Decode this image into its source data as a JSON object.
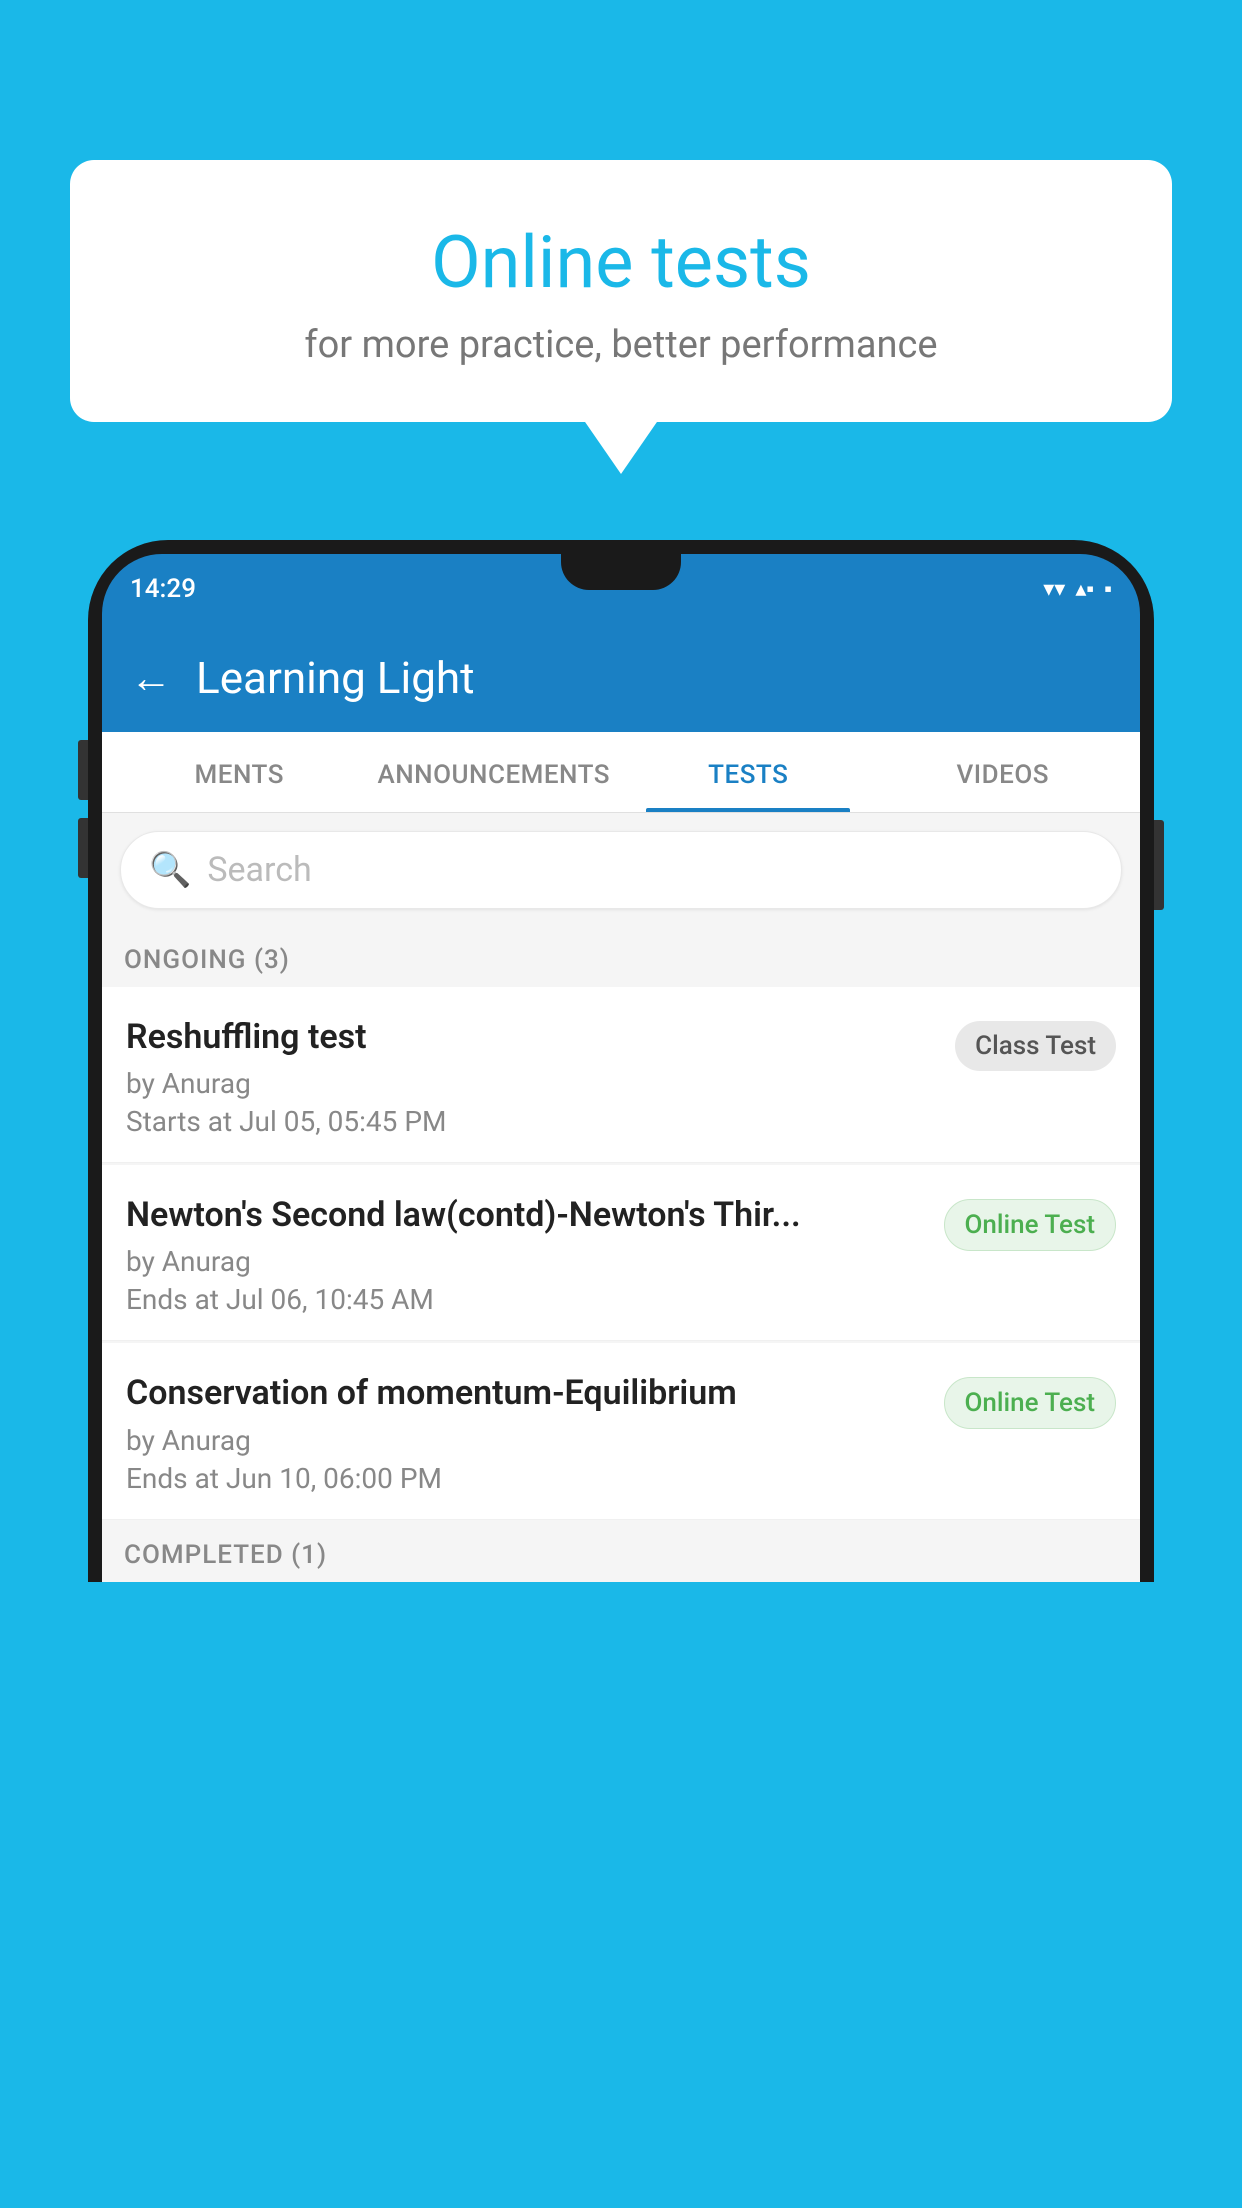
{
  "background_color": "#1ab8e8",
  "speech_bubble": {
    "title": "Online tests",
    "subtitle": "for more practice, better performance"
  },
  "phone": {
    "status_bar": {
      "time": "14:29",
      "wifi_icon": "▾",
      "signal_icon": "▴▴",
      "battery_icon": "▪"
    },
    "app_header": {
      "back_label": "←",
      "title": "Learning Light"
    },
    "tabs": [
      {
        "label": "MENTS",
        "active": false
      },
      {
        "label": "ANNOUNCEMENTS",
        "active": false
      },
      {
        "label": "TESTS",
        "active": true
      },
      {
        "label": "VIDEOS",
        "active": false
      }
    ],
    "search": {
      "placeholder": "Search"
    },
    "ongoing_section": {
      "label": "ONGOING (3)",
      "tests": [
        {
          "name": "Reshuffling test",
          "author": "by Anurag",
          "time_label": "Starts at",
          "time": "Jul 05, 05:45 PM",
          "badge": "Class Test",
          "badge_type": "class"
        },
        {
          "name": "Newton's Second law(contd)-Newton's Thir...",
          "author": "by Anurag",
          "time_label": "Ends at",
          "time": "Jul 06, 10:45 AM",
          "badge": "Online Test",
          "badge_type": "online"
        },
        {
          "name": "Conservation of momentum-Equilibrium",
          "author": "by Anurag",
          "time_label": "Ends at",
          "time": "Jun 10, 06:00 PM",
          "badge": "Online Test",
          "badge_type": "online"
        }
      ]
    },
    "completed_section": {
      "label": "COMPLETED (1)"
    }
  }
}
